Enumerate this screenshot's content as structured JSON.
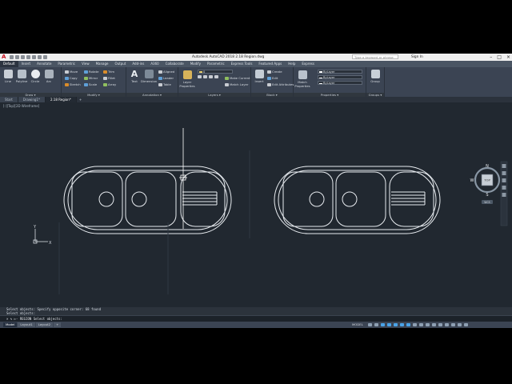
{
  "app": {
    "title": "Autodesk AutoCAD 2018    2.18 Region.dwg",
    "search_placeholder": "Type a keyword or phrase",
    "signin": "Sign In",
    "logo": "A"
  },
  "ribbon_tabs": [
    "Default",
    "Insert",
    "Annotate",
    "Parametric",
    "View",
    "Manage",
    "Output",
    "Add-ins",
    "A360",
    "Collaborate",
    "Modify",
    "Parametric",
    "Express Tools",
    "Featured Apps",
    "Help",
    "Express"
  ],
  "panels": {
    "draw": {
      "label": "Draw ▾",
      "line": "Line",
      "polyline": "Polyline",
      "circle": "Circle",
      "arc": "Arc"
    },
    "modify": {
      "label": "Modify ▾",
      "move": "Move",
      "rotate": "Rotate",
      "trim": "Trim",
      "copy": "Copy",
      "mirror": "Mirror",
      "fillet": "Fillet",
      "stretch": "Stretch",
      "scale": "Scale",
      "array": "Array"
    },
    "annotation": {
      "label": "Annotation ▾",
      "text": "Text",
      "dimension": "Dimension",
      "aligned": "Aligned",
      "leader": "Leader",
      "table": "Table"
    },
    "layers": {
      "label": "Layers ▾",
      "layer_properties": "Layer Properties",
      "make_current": "Make Current",
      "match_layer": "Match Layer"
    },
    "block": {
      "label": "Block ▾",
      "insert": "Insert",
      "create": "Create",
      "edit": "Edit",
      "edit_attributes": "Edit Attributes"
    },
    "properties": {
      "label": "Properties ▾",
      "match_properties": "Match Properties",
      "bylayer1": "ByLayer",
      "bylayer2": "ByLayer",
      "bylayer3": "ByLayer"
    },
    "groups": {
      "label": "Groups ▾",
      "group": "Group"
    }
  },
  "doc_tabs": [
    "Start",
    "Drawing1*",
    "2.18 Region*"
  ],
  "viewport_label": "[-][Top][2D Wireframe]",
  "viewcube": {
    "n": "N",
    "s": "S",
    "e": "E",
    "w": "W",
    "top": "TOP",
    "wcs": "WCS"
  },
  "ucs": {
    "x": "X",
    "y": "Y"
  },
  "command": {
    "history": [
      "Select objects: Specify opposite corner: 68 found",
      "Select objects:"
    ],
    "prompt": "× ✎ ▷- REGION Select objects:"
  },
  "status": {
    "layout_tabs": [
      "Model",
      "Layout1",
      "Layout2",
      "+"
    ],
    "model": "MODEL"
  },
  "colors": {
    "accent": "#4aa3e8",
    "drawing": "#e8ecf0",
    "canvas": "#212830"
  }
}
